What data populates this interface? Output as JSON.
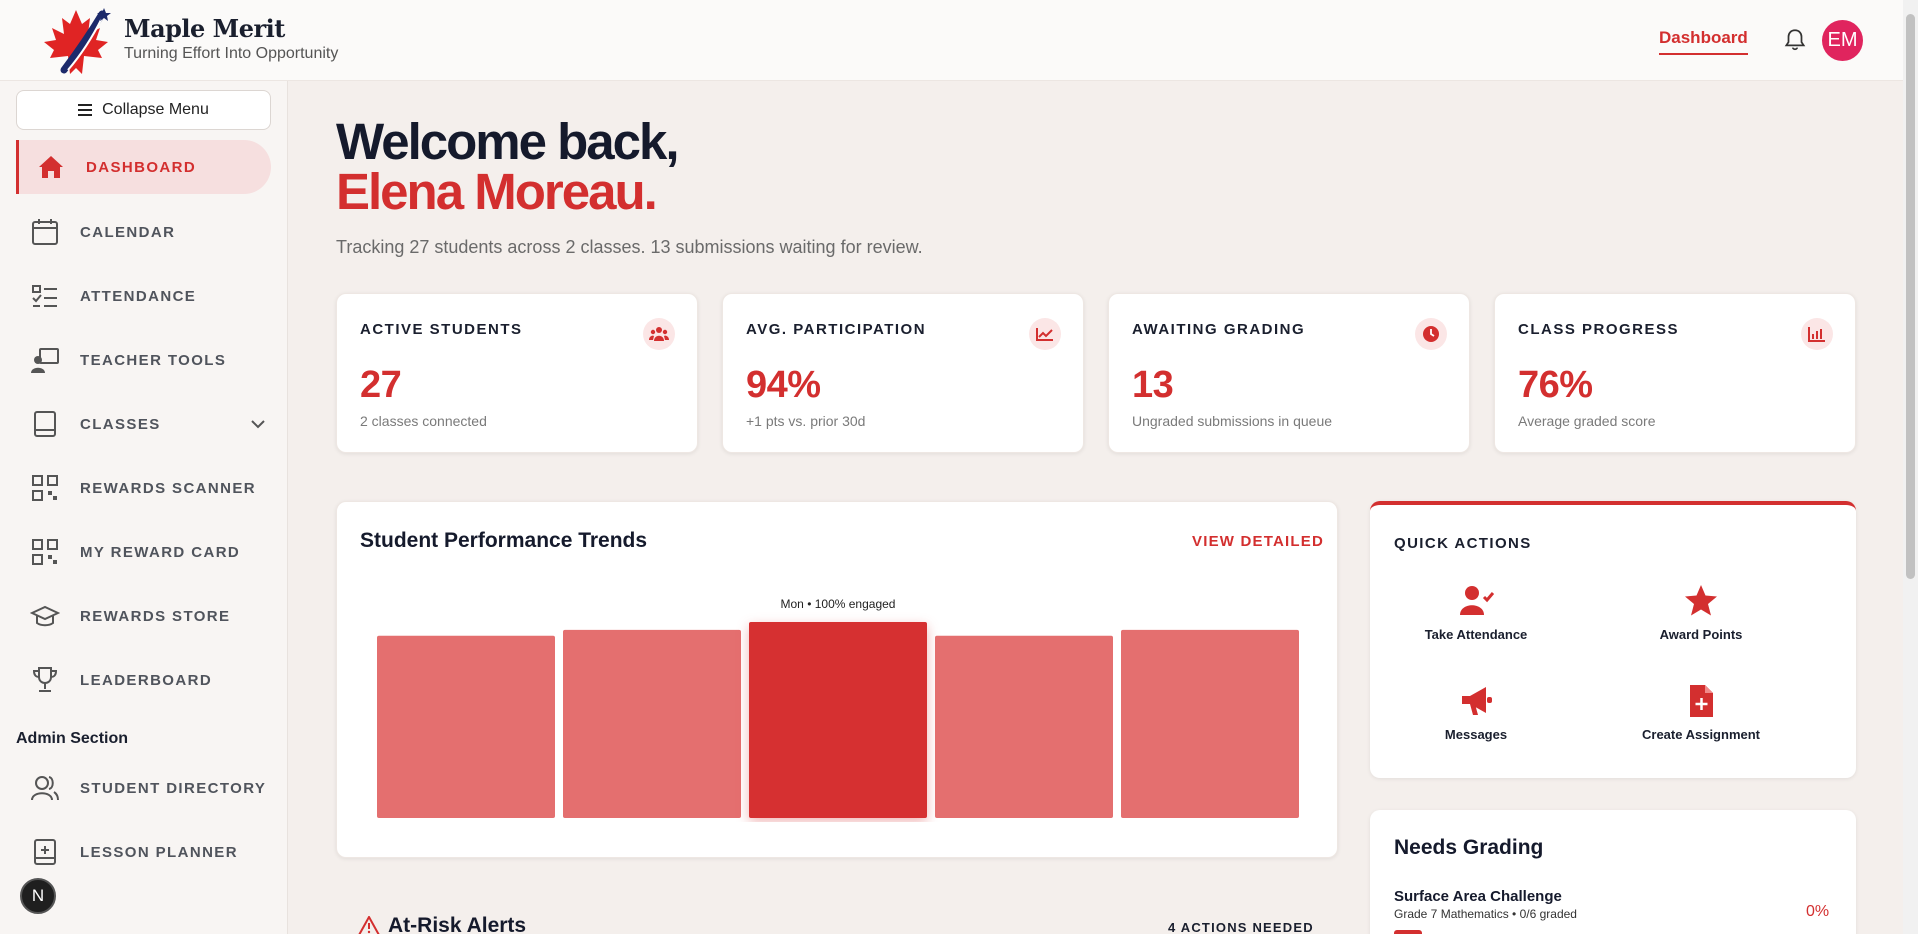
{
  "header": {
    "brand_name": "Maple Merit",
    "brand_tagline": "Turning Effort Into Opportunity",
    "nav_dashboard": "Dashboard",
    "avatar_initials": "EM",
    "accent_color": "#d32f2f"
  },
  "sidebar": {
    "collapse_label": "Collapse Menu",
    "items": [
      {
        "label": "DASHBOARD",
        "icon": "home-icon",
        "active": true
      },
      {
        "label": "CALENDAR",
        "icon": "calendar-icon"
      },
      {
        "label": "ATTENDANCE",
        "icon": "checklist-icon"
      },
      {
        "label": "TEACHER TOOLS",
        "icon": "teacher-icon"
      },
      {
        "label": "CLASSES",
        "icon": "book-icon"
      },
      {
        "label": "REWARDS SCANNER",
        "icon": "qr-icon"
      },
      {
        "label": "MY REWARD CARD",
        "icon": "qr-icon"
      },
      {
        "label": "REWARDS STORE",
        "icon": "graduation-cap-icon"
      },
      {
        "label": "LEADERBOARD",
        "icon": "trophy-icon"
      }
    ],
    "admin_section_label": "Admin Section",
    "admin_items": [
      {
        "label": "STUDENT DIRECTORY",
        "icon": "users-icon"
      },
      {
        "label": "LESSON PLANNER",
        "icon": "planner-icon"
      }
    ],
    "badge_letter": "N"
  },
  "main": {
    "welcome_line": "Welcome back,",
    "welcome_name": "Elena Moreau.",
    "subtitle": "Tracking 27 students across 2 classes. 13 submissions waiting for review.",
    "stats": [
      {
        "label": "ACTIVE STUDENTS",
        "value": "27",
        "note": "2 classes connected",
        "icon": "users-icon"
      },
      {
        "label": "AVG. PARTICIPATION",
        "value": "94%",
        "note": "+1 pts vs. prior 30d",
        "icon": "trend-icon"
      },
      {
        "label": "AWAITING GRADING",
        "value": "13",
        "note": "Ungraded submissions in queue",
        "icon": "clock-icon"
      },
      {
        "label": "CLASS PROGRESS",
        "value": "76%",
        "note": "Average graded score",
        "icon": "bar-chart-icon"
      }
    ],
    "performance": {
      "title": "Student Performance Trends",
      "link_label": "VIEW DETAILED"
    },
    "quick_actions": {
      "title": "QUICK ACTIONS",
      "items": [
        {
          "label": "Take Attendance",
          "icon": "user-check-icon"
        },
        {
          "label": "Award Points",
          "icon": "star-icon"
        },
        {
          "label": "Messages",
          "icon": "megaphone-icon"
        },
        {
          "label": "Create Assignment",
          "icon": "file-plus-icon"
        }
      ]
    },
    "needs_grading": {
      "title": "Needs Grading",
      "item_name": "Surface Area Challenge",
      "item_meta": "Grade 7 Mathematics • 0/6 graded",
      "item_percent": "0%"
    },
    "at_risk": {
      "title": "At-Risk Alerts",
      "count_label": "4 ACTIONS NEEDED"
    }
  },
  "chart_data": {
    "type": "bar",
    "categories": [
      "",
      "",
      "",
      "",
      ""
    ],
    "values": [
      93,
      96,
      100,
      93,
      96
    ],
    "ylim": [
      0,
      100
    ],
    "highlighted_index": 2,
    "highlight_tooltip": "Mon • 100% engaged",
    "colors": {
      "normal": "#e46f6f",
      "highlight": "#d63031"
    }
  }
}
